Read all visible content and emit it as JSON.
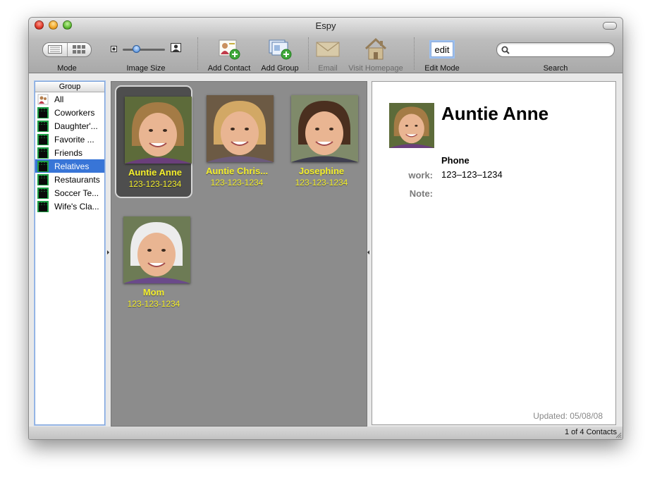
{
  "window": {
    "title": "Espy"
  },
  "toolbar": {
    "mode_label": "Mode",
    "image_size_label": "Image Size",
    "add_contact_label": "Add Contact",
    "add_group_label": "Add Group",
    "email_label": "Email",
    "visit_homepage_label": "Visit Homepage",
    "edit_mode_label": "Edit Mode",
    "edit_field_value": "edit",
    "search_label": "Search",
    "search_value": ""
  },
  "sidebar": {
    "header": "Group",
    "items": [
      {
        "label": "All"
      },
      {
        "label": "Coworkers"
      },
      {
        "label": "Daughter'..."
      },
      {
        "label": "Favorite ..."
      },
      {
        "label": "Friends"
      },
      {
        "label": "Relatives",
        "selected": true
      },
      {
        "label": "Restaurants"
      },
      {
        "label": "Soccer Te..."
      },
      {
        "label": "Wife's Cla..."
      }
    ]
  },
  "contacts": [
    {
      "name": "Auntie Anne",
      "phone": "123-123-1234",
      "selected": true
    },
    {
      "name": "Auntie Chris...",
      "phone": "123-123-1234"
    },
    {
      "name": "Josephine",
      "phone": "123-123-1234"
    },
    {
      "name": "Mom",
      "phone": "123-123-1234"
    }
  ],
  "detail": {
    "name": "Auntie Anne",
    "phone_heading": "Phone",
    "work_label": "work:",
    "work_value": "123–123–1234",
    "note_label": "Note:",
    "updated": "Updated: 05/08/08"
  },
  "status": {
    "count": "1 of 4 Contacts"
  },
  "colors": {
    "selection": "#3875d7",
    "contact_text": "#f3ee2c",
    "grid_bg": "#8c8c8c"
  }
}
